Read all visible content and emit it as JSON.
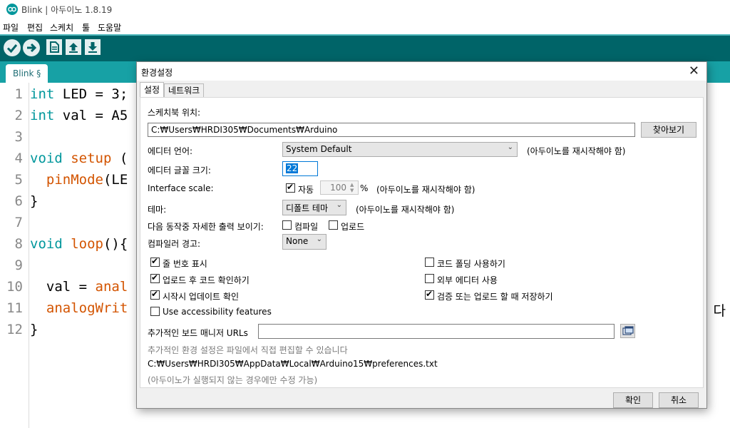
{
  "window": {
    "title": "Blink | 아두이노 1.8.19"
  },
  "menu": [
    "파일",
    "편집",
    "스케치",
    "툴",
    "도움말"
  ],
  "tabs": {
    "active": "Blink §"
  },
  "editor": {
    "line_numbers": [
      "1",
      "2",
      "3",
      "4",
      "5",
      "6",
      "7",
      "8",
      "9",
      "10",
      "11",
      "12"
    ],
    "lines": [
      "int LED = 3;",
      "int val = A5",
      "",
      "void setup (",
      "  pinMode(LE",
      "}",
      "",
      "void loop(){",
      "",
      "  val = anal",
      "  analogWrit",
      "}"
    ],
    "right_glyph": "다"
  },
  "dialog": {
    "title": "환경설정",
    "close": "✕",
    "tabs": {
      "settings": "설정",
      "network": "네트워크"
    },
    "sketchbook_label": "스케치북 위치:",
    "sketchbook_path": "C:₩Users₩HRDI305₩Documents₩Arduino",
    "browse_button": "찾아보기",
    "editor_language_label": "에디터 언어:",
    "editor_language_value": "System Default",
    "restart_note": "(아두이노를 재시작해야 함)",
    "font_size_label": "에디터 글꼴 크기:",
    "font_size_value": "22",
    "interface_scale_label": "Interface scale:",
    "auto_label": "자동",
    "scale_value": "100",
    "percent": "%",
    "theme_label": "테마:",
    "theme_value": "디폴트 테마",
    "verbose_label": "다음 동작중 자세한  출력 보이기:",
    "verbose_compile": "컴파일",
    "verbose_upload": "업로드",
    "compiler_warnings_label": "컴파일러 경고:",
    "compiler_warnings_value": "None",
    "options": {
      "line_numbers": "줄 번호 표시",
      "verify_after_upload": "업로드 후 코드 확인하기",
      "check_updates": "시작시 업데이트 확인",
      "accessibility": "Use accessibility features",
      "code_folding": "코드 폴딩 사용하기",
      "external_editor": "외부 에디터 사용",
      "save_on_verify": "검증 또는 업로드 할 때 저장하기"
    },
    "checked": {
      "auto_scale": true,
      "verbose_compile": false,
      "verbose_upload": false,
      "line_numbers": true,
      "verify_after_upload": true,
      "check_updates": true,
      "accessibility": false,
      "code_folding": false,
      "external_editor": false,
      "save_on_verify": true
    },
    "board_urls_label": "추가적인 보드 매니저 URLs",
    "board_urls_value": "",
    "more_prefs_note": "추가적인 환경 설정은 파일에서 직접 편집할 수 있습니다",
    "prefs_path": "C:₩Users₩HRDI305₩AppData₩Local₩Arduino15₩preferences.txt",
    "edit_note": "(아두이노가 실행되지 않는 경우에만 수정 가능)",
    "ok_button": "확인",
    "cancel_button": "취소"
  },
  "colors": {
    "toolbar": "#006468",
    "tabbar": "#17a1a5",
    "keyword": "#00979c",
    "function": "#d35400"
  }
}
